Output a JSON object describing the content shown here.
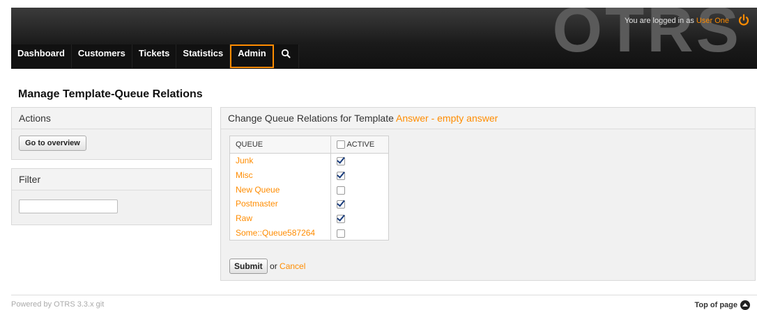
{
  "header": {
    "logo_text": "OTRS",
    "login_prefix": "You are logged in as",
    "user_name": "User One",
    "nav": [
      {
        "label": "Dashboard"
      },
      {
        "label": "Customers"
      },
      {
        "label": "Tickets"
      },
      {
        "label": "Statistics"
      },
      {
        "label": "Admin",
        "active": true
      }
    ],
    "search_icon": "search-icon",
    "logout_icon": "power-icon"
  },
  "page_title": "Manage Template-Queue Relations",
  "sidebar": {
    "actions_title": "Actions",
    "goto_overview_label": "Go to overview",
    "filter_title": "Filter",
    "filter_value": ""
  },
  "main": {
    "header_prefix": "Change Queue Relations for Template",
    "template_name": "Answer - empty answer",
    "table": {
      "col_queue": "QUEUE",
      "col_active": "ACTIVE",
      "rows": [
        {
          "queue": "Junk",
          "active": true
        },
        {
          "queue": "Misc",
          "active": true
        },
        {
          "queue": "New Queue",
          "active": false
        },
        {
          "queue": "Postmaster",
          "active": true
        },
        {
          "queue": "Raw",
          "active": true
        },
        {
          "queue": "Some::Queue587264",
          "active": false
        }
      ]
    },
    "submit_label": "Submit",
    "or_text": "or",
    "cancel_label": "Cancel"
  },
  "footer": {
    "powered_by": "Powered by OTRS 3.3.x git",
    "top_of_page": "Top of page"
  },
  "colors": {
    "accent": "#ff8c00",
    "header_bg": "#1a1a1a"
  }
}
